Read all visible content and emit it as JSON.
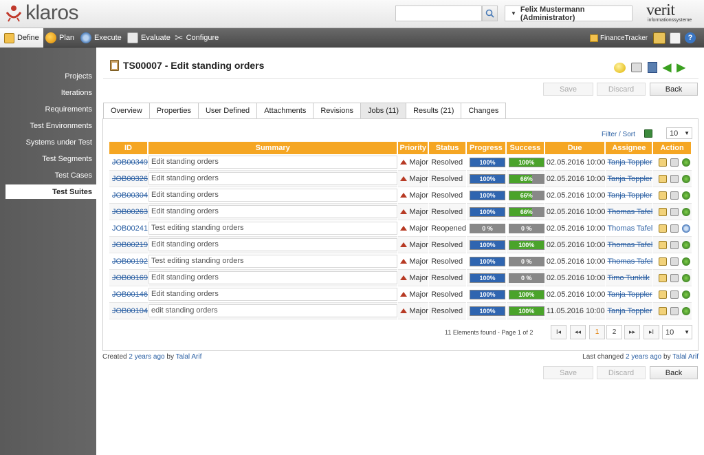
{
  "header": {
    "logo_text": "klaros",
    "search_placeholder": "",
    "user_label": "Felix Mustermann (Administrator)",
    "brand_right": "verit",
    "brand_right_sub": "informationssysteme"
  },
  "nav": {
    "items": [
      {
        "label": "Define",
        "icon": "define-icon"
      },
      {
        "label": "Plan",
        "icon": "plan-icon"
      },
      {
        "label": "Execute",
        "icon": "execute-icon"
      },
      {
        "label": "Evaluate",
        "icon": "evaluate-icon"
      },
      {
        "label": "Configure",
        "icon": "configure-icon"
      }
    ],
    "project_label": "FinanceTracker"
  },
  "sidebar": {
    "items": [
      {
        "label": "Projects"
      },
      {
        "label": "Iterations"
      },
      {
        "label": "Requirements"
      },
      {
        "label": "Test Environments"
      },
      {
        "label": "Systems under Test"
      },
      {
        "label": "Test Segments"
      },
      {
        "label": "Test Cases"
      },
      {
        "label": "Test Suites"
      }
    ],
    "selected": "Test Suites"
  },
  "page": {
    "title": "TS00007 - Edit standing orders",
    "save_label": "Save",
    "discard_label": "Discard",
    "back_label": "Back"
  },
  "tabs": [
    {
      "label": "Overview"
    },
    {
      "label": "Properties"
    },
    {
      "label": "User Defined"
    },
    {
      "label": "Attachments"
    },
    {
      "label": "Revisions"
    },
    {
      "label": "Jobs (11)"
    },
    {
      "label": "Results (21)"
    },
    {
      "label": "Changes"
    }
  ],
  "table": {
    "filter_label": "Filter / Sort",
    "page_size": "10",
    "columns": [
      "ID",
      "Summary",
      "Priority",
      "Status",
      "Progress",
      "Success",
      "Due",
      "Assignee",
      "Action"
    ],
    "rows": [
      {
        "id": "JOB00349",
        "summary": "Edit standing orders",
        "priority": "Major",
        "status": "Resolved",
        "progress": 100,
        "progress_label": "100%",
        "success": 100,
        "success_label": "100%",
        "due": "02.05.2016 10:00",
        "assignee": "Tanja Toppler",
        "struck": true
      },
      {
        "id": "JOB00326",
        "summary": "Edit standing orders",
        "priority": "Major",
        "status": "Resolved",
        "progress": 100,
        "progress_label": "100%",
        "success": 66,
        "success_label": "66%",
        "due": "02.05.2016 10:00",
        "assignee": "Tanja Toppler",
        "struck": true
      },
      {
        "id": "JOB00304",
        "summary": "Edit standing orders",
        "priority": "Major",
        "status": "Resolved",
        "progress": 100,
        "progress_label": "100%",
        "success": 66,
        "success_label": "66%",
        "due": "02.05.2016 10:00",
        "assignee": "Tanja Toppler",
        "struck": true
      },
      {
        "id": "JOB00263",
        "summary": "Edit standing orders",
        "priority": "Major",
        "status": "Resolved",
        "progress": 100,
        "progress_label": "100%",
        "success": 66,
        "success_label": "66%",
        "due": "02.05.2016 10:00",
        "assignee": "Thomas Tafel",
        "struck": true
      },
      {
        "id": "JOB00241",
        "summary": "Test editing standing orders",
        "priority": "Major",
        "status": "Reopened",
        "progress": 0,
        "progress_label": "0 %",
        "success": 0,
        "success_label": "0 %",
        "due": "02.05.2016 10:00",
        "assignee": "Thomas Tafel",
        "struck": false
      },
      {
        "id": "JOB00219",
        "summary": "Edit standing orders",
        "priority": "Major",
        "status": "Resolved",
        "progress": 100,
        "progress_label": "100%",
        "success": 100,
        "success_label": "100%",
        "due": "02.05.2016 10:00",
        "assignee": "Thomas Tafel",
        "struck": true
      },
      {
        "id": "JOB00192",
        "summary": "Test editing standing orders",
        "priority": "Major",
        "status": "Resolved",
        "progress": 100,
        "progress_label": "100%",
        "success": 0,
        "success_label": "0 %",
        "due": "02.05.2016 10:00",
        "assignee": "Thomas Tafel",
        "struck": true
      },
      {
        "id": "JOB00169",
        "summary": "Edit standing orders",
        "priority": "Major",
        "status": "Resolved",
        "progress": 100,
        "progress_label": "100%",
        "success": 0,
        "success_label": "0 %",
        "due": "02.05.2016 10:00",
        "assignee": "Timo Tunklik",
        "struck": true
      },
      {
        "id": "JOB00146",
        "summary": "Edit standing orders",
        "priority": "Major",
        "status": "Resolved",
        "progress": 100,
        "progress_label": "100%",
        "success": 100,
        "success_label": "100%",
        "due": "02.05.2016 10:00",
        "assignee": "Tanja Toppler",
        "struck": true
      },
      {
        "id": "JOB00104",
        "summary": "edit standing orders",
        "priority": "Major",
        "status": "Resolved",
        "progress": 100,
        "progress_label": "100%",
        "success": 100,
        "success_label": "100%",
        "due": "11.05.2016 10:00",
        "assignee": "Tanja Toppler",
        "struck": true
      }
    ]
  },
  "pager": {
    "summary": "11 Elements found - Page 1 of 2",
    "first": "I◂",
    "prev": "◂◂",
    "pages": [
      "1",
      "2"
    ],
    "next": "▸▸",
    "last": "▸I",
    "page_size": "10"
  },
  "footer": {
    "created_prefix": "Created",
    "created_when": "2 years ago",
    "by": "by",
    "created_by": "Talal Arif",
    "changed_prefix": "Last changed",
    "changed_when": "2 years ago",
    "changed_by": "Talal Arif"
  },
  "colors": {
    "header_orange": "#f5a623",
    "progress_blue": "#2f65b0",
    "success_green": "#4aa32a",
    "empty_gray": "#888888",
    "link_blue": "#2a5fa3",
    "priority_red": "#b73a24"
  }
}
